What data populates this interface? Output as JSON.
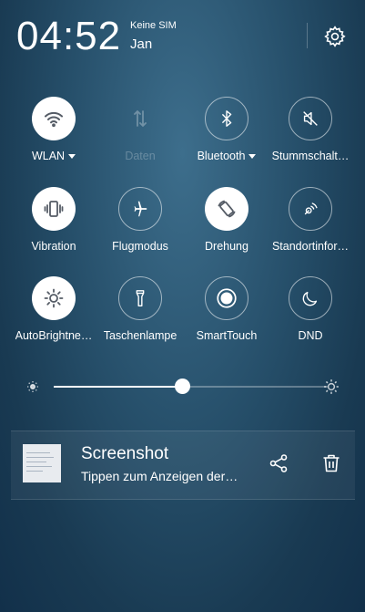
{
  "status": {
    "time": "04:52",
    "sim": "Keine SIM",
    "month": "Jan",
    "settings_icon": "gear-icon"
  },
  "toggles": [
    {
      "label": "WLAN",
      "icon": "wifi-icon",
      "state": "on"
    },
    {
      "label": "Daten",
      "icon": "mobile-data-icon",
      "state": "unavailable"
    },
    {
      "label": "Bluetooth",
      "icon": "bluetooth-icon",
      "state": "off"
    },
    {
      "label": "Stummschalt…",
      "icon": "mute-icon",
      "state": "off"
    },
    {
      "label": "Vibration",
      "icon": "vibration-icon",
      "state": "on"
    },
    {
      "label": "Flugmodus",
      "icon": "airplane-icon",
      "state": "off"
    },
    {
      "label": "Drehung",
      "icon": "rotation-icon",
      "state": "on"
    },
    {
      "label": "Standortinfor…",
      "icon": "location-icon",
      "state": "off"
    },
    {
      "label": "AutoBrightne…",
      "icon": "brightness-icon",
      "state": "on"
    },
    {
      "label": "Taschenlampe",
      "icon": "flashlight-icon",
      "state": "off"
    },
    {
      "label": "SmartTouch",
      "icon": "smarttouch-icon",
      "state": "off"
    },
    {
      "label": "DND",
      "icon": "moon-icon",
      "state": "off"
    }
  ],
  "brightness": {
    "level": 0.47
  },
  "notification": {
    "title": "Screenshot",
    "subtitle": "Tippen zum Anzeigen der…",
    "share_icon": "share-icon",
    "delete_icon": "trash-icon"
  },
  "colors": {
    "accent": "#ffffff",
    "background": "#264f6a"
  }
}
